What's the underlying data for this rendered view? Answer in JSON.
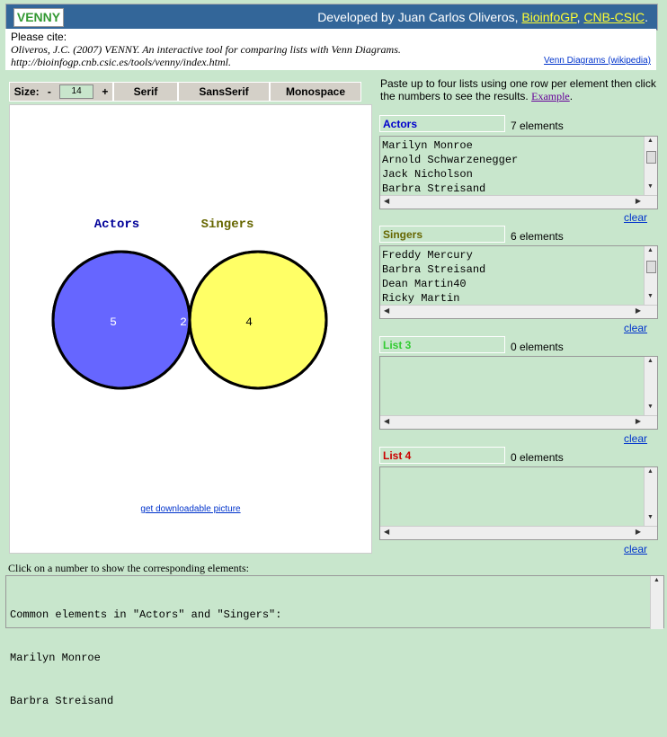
{
  "header": {
    "logo": "VENNY",
    "developed_prefix": "Developed by Juan Carlos Oliveros,",
    "link1": "BioinfoGP",
    "sep": ",",
    "link2": "CNB-CSIC",
    "suffix": "."
  },
  "cite": {
    "line1": "Please cite:",
    "line2": "Oliveros, J.C. (2007) VENNY. An interactive tool for comparing lists with Venn Diagrams.",
    "line3": "http://bioinfogp.cnb.csic.es/tools/venny/index.html.",
    "wiki_link": "Venn Diagrams (wikipedia)"
  },
  "toolbar": {
    "size_label": "Size:",
    "minus": "-",
    "size_value": "14",
    "plus": "+",
    "serif": "Serif",
    "sans": "SansSerif",
    "mono": "Monospace"
  },
  "venn": {
    "label_a": "Actors",
    "label_b": "Singers",
    "only_a": "5",
    "both": "2",
    "only_b": "4",
    "colors": {
      "a": "#6666ff",
      "b": "#ffff66",
      "overlap": "#a3a375",
      "label_a": "#000099",
      "label_b": "#666600"
    }
  },
  "download_link": "get downloadable picture",
  "instructions": {
    "text": "Paste up to four lists using one row per element then click the numbers to see the results.",
    "example": "Example"
  },
  "lists": [
    {
      "name": "Actors",
      "count": "7 elements",
      "color": "#0000cc",
      "items": [
        "Marilyn Monroe",
        "Arnold Schwarzenegger",
        "Jack Nicholson",
        "Barbra Streisand"
      ],
      "clear": "clear"
    },
    {
      "name": "Singers",
      "count": "6 elements",
      "color": "#666600",
      "items": [
        "Freddy Mercury",
        "Barbra Streisand",
        "Dean Martin40",
        "Ricky Martin"
      ],
      "clear": "clear"
    },
    {
      "name": "List 3",
      "count": "0 elements",
      "color": "#33cc33",
      "items": [],
      "clear": "clear"
    },
    {
      "name": "List 4",
      "count": "0 elements",
      "color": "#cc0000",
      "items": [],
      "clear": "clear"
    }
  ],
  "result": {
    "label": "Click on a number to show the corresponding elements:",
    "lines": [
      "Common elements in \"Actors\" and \"Singers\":",
      "Marilyn Monroe",
      "Barbra Streisand"
    ]
  }
}
